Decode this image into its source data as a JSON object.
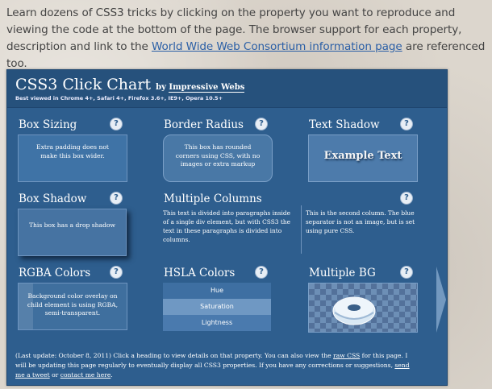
{
  "intro": {
    "text_before_link": "Learn dozens of CSS3 tricks by clicking on the property you want to reproduce and viewing the code at the bottom of the page. The browser support for each property, description and link to the ",
    "link": "World Wide Web Consortium information page",
    "text_after_link": " are referenced too."
  },
  "chart": {
    "title": "CSS3 Click Chart",
    "by": "by",
    "author": "Impressive Webs",
    "support": "Best viewed in Chrome 4+, Safari 4+, Firefox 3.6+, IE9+, Opera 10.5+",
    "help_glyph": "?",
    "properties": {
      "box_sizing": {
        "title": "Box Sizing",
        "demo": "Extra padding does not make this box wider."
      },
      "border_radius": {
        "title": "Border Radius",
        "demo": "This box has rounded corners using CSS, with no images or extra markup"
      },
      "text_shadow": {
        "title": "Text Shadow",
        "demo": "Example Text"
      },
      "box_shadow": {
        "title": "Box Shadow",
        "demo": "This box has a drop shadow"
      },
      "multiple_columns": {
        "title": "Multiple Columns",
        "col1": "This text is divided into paragraphs inside of a single div element, but with CSS3 the text in these paragraphs is divided into columns.",
        "col2": "This is the second column. The blue separator is not an image, but is set using pure CSS."
      },
      "rgba": {
        "title": "RGBA Colors",
        "demo": "Background color overlay on child element is using RGBA, semi-transparent."
      },
      "hsla": {
        "title": "HSLA Colors",
        "rows": [
          "Hue",
          "Saturation",
          "Lightness"
        ]
      },
      "multiple_bg": {
        "title": "Multiple BG"
      }
    },
    "footer": {
      "t1": "(Last update: October 8, 2011) Click a heading to view details on that property. You can also view the ",
      "l1": "raw CSS",
      "t2": " for this page. I will be updating this page regularly to eventually display all CSS3 properties. If you have any corrections or suggestions, ",
      "l2": "send me a tweet",
      "t3": " or ",
      "l3": "contact me here",
      "t4": "."
    }
  },
  "icons": {
    "next": "next-arrow-icon",
    "help": "help-icon",
    "donut": "donut-image"
  },
  "colors": {
    "chart_bg": "#2e5e8e",
    "link": "#2b5fa6",
    "page_bg": "#dcd6cd"
  }
}
